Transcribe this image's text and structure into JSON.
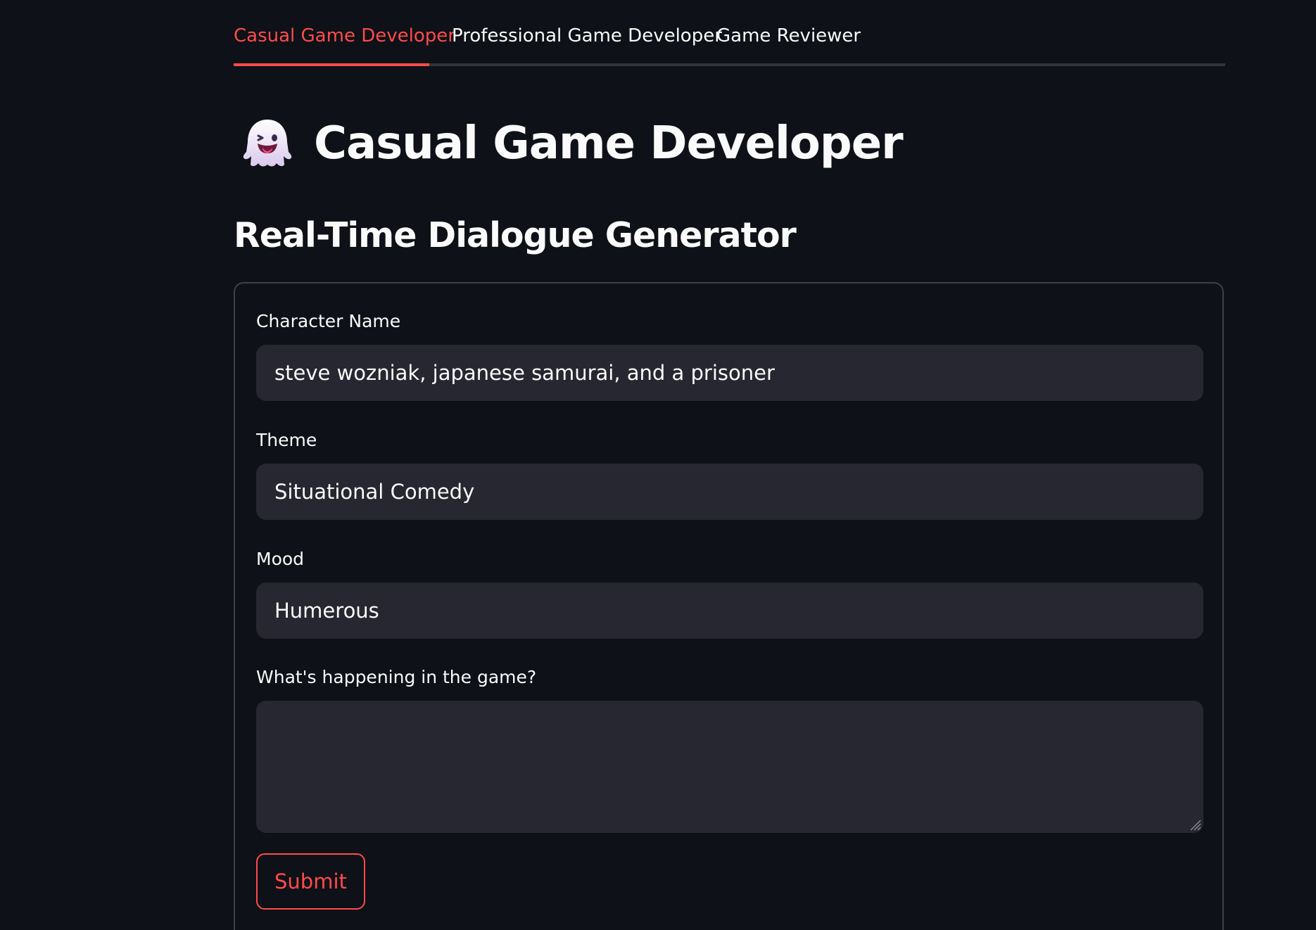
{
  "tabs": [
    {
      "label": "Casual Game Developer",
      "active": true
    },
    {
      "label": "Professional Game Developer",
      "active": false
    },
    {
      "label": "Game Reviewer",
      "active": false
    }
  ],
  "page": {
    "icon": "ghost-icon",
    "title": "Casual Game Developer",
    "subheader": "Real-Time Dialogue Generator"
  },
  "form": {
    "fields": [
      {
        "label": "Character Name",
        "value": "steve wozniak, japanese samurai, and a prisoner"
      },
      {
        "label": "Theme",
        "value": "Situational Comedy"
      },
      {
        "label": "Mood",
        "value": "Humerous"
      },
      {
        "label": "What's happening in the game?",
        "value": ""
      }
    ],
    "submit_label": "Submit"
  },
  "colors": {
    "background": "#0e1117",
    "accent": "#ff4b4b",
    "input_background": "#262730",
    "text": "#fafafa"
  }
}
